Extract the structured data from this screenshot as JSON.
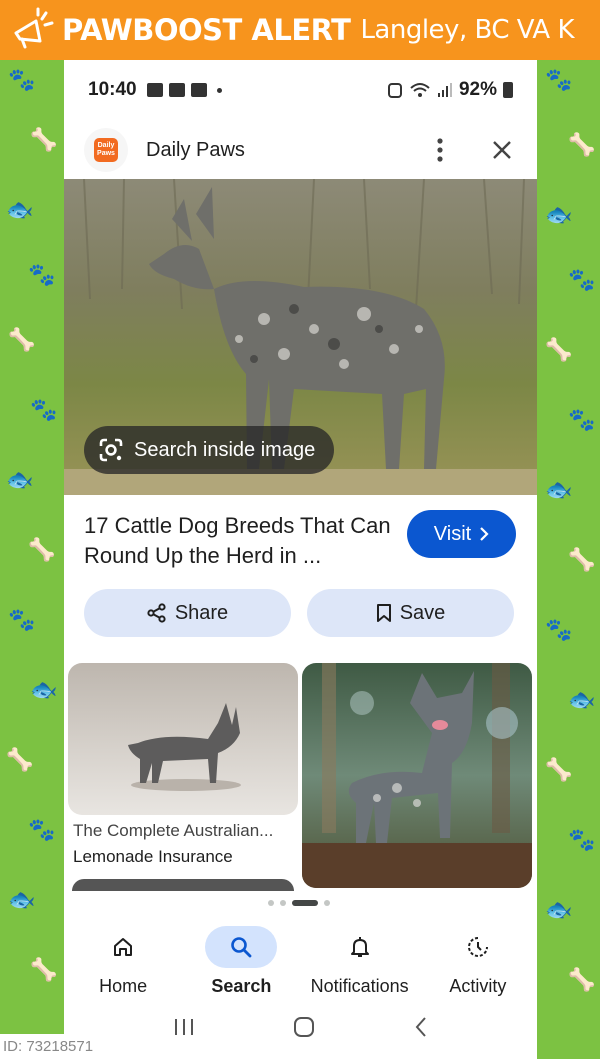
{
  "banner": {
    "brand": "PAWBOOST ALERT",
    "location": "Langley, BC VA K"
  },
  "statusbar": {
    "time": "10:40",
    "battery": "92%"
  },
  "source": {
    "logo_text": "Daily Paws",
    "name": "Daily Paws"
  },
  "hero": {
    "lens_label": "Search inside image"
  },
  "result": {
    "title": "17 Cattle Dog Breeds That Can Round Up the Herd in ...",
    "visit_label": "Visit"
  },
  "actions": {
    "share_label": "Share",
    "save_label": "Save"
  },
  "related": [
    {
      "title": "The Complete Australian...",
      "source": "Lemonade Insurance"
    }
  ],
  "nav": {
    "items": [
      {
        "label": "Home",
        "icon": "home-icon"
      },
      {
        "label": "Search",
        "icon": "search-icon",
        "active": true
      },
      {
        "label": "Notifications",
        "icon": "bell-icon"
      },
      {
        "label": "Activity",
        "icon": "activity-icon"
      }
    ]
  },
  "footer": {
    "id_text": "ID: 73218571"
  },
  "colors": {
    "banner": "#f7941d",
    "background": "#7cc242",
    "accent": "#0b57d0",
    "pill": "#dde6f8",
    "nav_active": "#d3e3fd"
  }
}
